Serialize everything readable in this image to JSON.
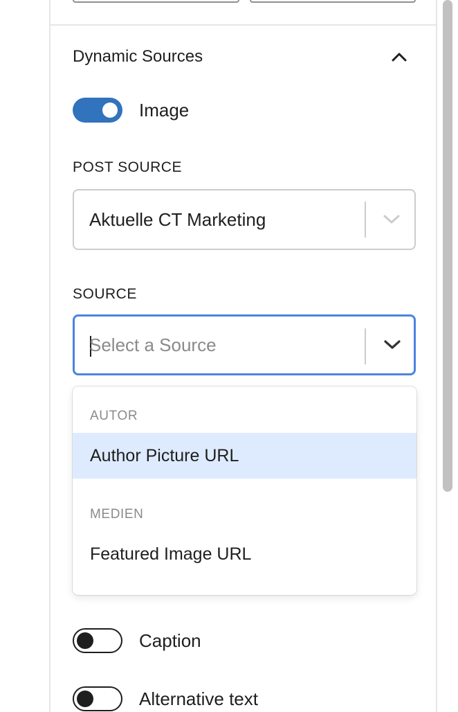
{
  "dynamic_sources": {
    "title": "Dynamic Sources",
    "collapse_icon": "chevron-up-icon",
    "image_toggle": {
      "label": "Image",
      "checked": true
    }
  },
  "post_source": {
    "label": "POST SOURCE",
    "value": "Aktuelle CT Marketing",
    "indicator_icon": "chevron-down-icon"
  },
  "source": {
    "label": "SOURCE",
    "placeholder": "Select a Source",
    "indicator_icon": "chevron-down-icon",
    "menu": {
      "groups": [
        {
          "heading": "AUTOR",
          "options": [
            {
              "label": "Author Picture URL",
              "highlighted": true
            }
          ]
        },
        {
          "heading": "MEDIEN",
          "options": [
            {
              "label": "Featured Image URL",
              "highlighted": false
            }
          ]
        }
      ]
    }
  },
  "caption_toggle": {
    "label": "Caption",
    "checked": false
  },
  "alt_text_toggle": {
    "label": "Alternative text",
    "checked": false
  },
  "colors": {
    "accent": "#3173bd",
    "focus_border": "#4b83e3",
    "option_highlight": "#deebff"
  }
}
